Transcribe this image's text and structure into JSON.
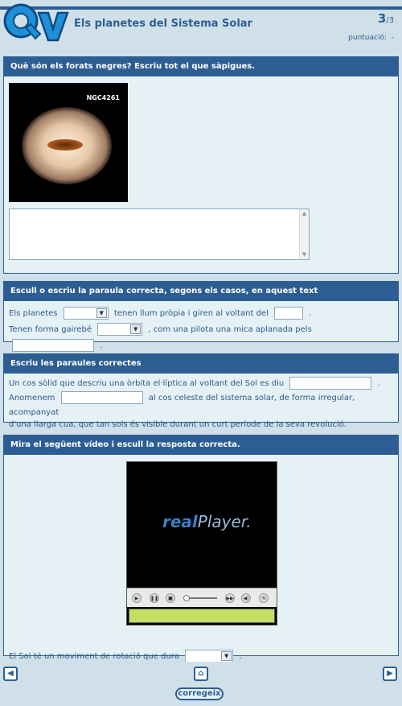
{
  "header": {
    "title": "Els planetes del Sistema Solar",
    "page_current": "3",
    "page_total": "/3",
    "score_label": "puntuació:",
    "score_value": "-"
  },
  "q1": {
    "prompt": "Què són els forats negres? Escriu tot el que sàpigues.",
    "image_label": "NGC4261",
    "answer_value": ""
  },
  "q2": {
    "prompt": "Escull o escriu la paraula correcta, segons els casos, en aquest text",
    "line1_a": "Els planetes",
    "line1_b": "tenen llum pròpia i giren al voltant del",
    "line1_end": ".",
    "line2_a": "Tenen forma gairebé",
    "line2_b": ", com una pilota una mica aplanada pels",
    "line2_end": "."
  },
  "q3": {
    "prompt": "Escriu les paraules correctes",
    "line1": "Un cos sòlid que descriu una òrbita el·líptica al voltant del Sol es diu",
    "line1_end": ".",
    "line2_a": "Anomenem",
    "line2_b": "al cos celeste del sistema solar, de forma irregular, acompanyat",
    "line3": "d'una llarga cua, que  tan sols és visible durant un curt període de la seva revolució."
  },
  "q4": {
    "prompt": "Mira el següent vídeo i escull la resposta correcta.",
    "player_brand_a": "real",
    "player_brand_b": "Player",
    "player_brand_c": ".",
    "answer_text": "El Sol té un moviment de rotació que dura",
    "answer_end": "."
  },
  "footer": {
    "correct_label": "corregeix"
  },
  "colors": {
    "accent": "#2c5e93",
    "background": "#cfe0e8",
    "card": "#e6f1f5",
    "player_status": "#c6de62"
  },
  "icons": {
    "prev": "arrow-left-icon",
    "home": "home-icon",
    "next": "arrow-right-icon"
  }
}
